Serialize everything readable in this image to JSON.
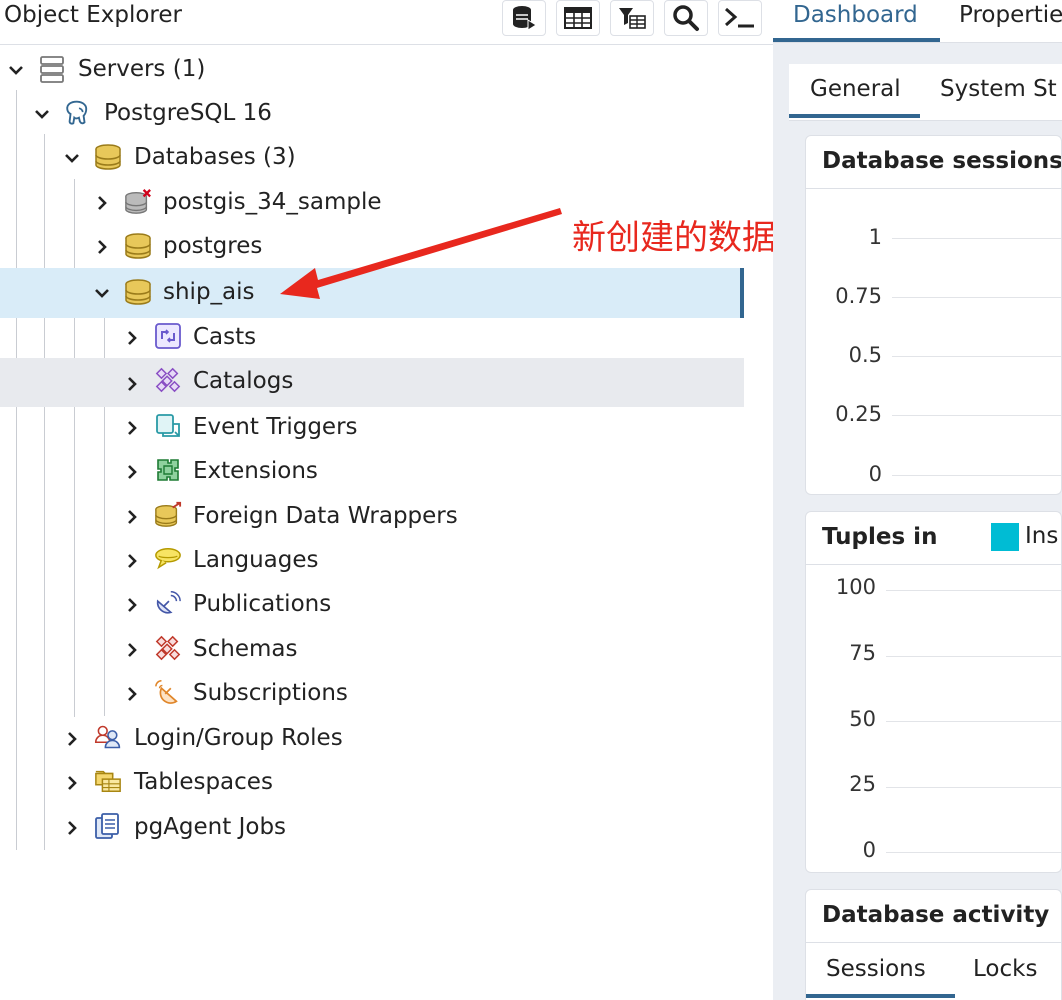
{
  "object_explorer": {
    "title": "Object Explorer",
    "toolbar": [
      {
        "icon": "query-tool-icon"
      },
      {
        "icon": "view-data-icon"
      },
      {
        "icon": "filtered-rows-icon"
      },
      {
        "icon": "search-icon"
      },
      {
        "icon": "psql-tool-icon"
      }
    ]
  },
  "tree": [
    {
      "label": "Servers (1)",
      "icon": "servers-icon",
      "expanded": true
    },
    {
      "label": "PostgreSQL 16",
      "icon": "postgresql-elephant-icon",
      "expanded": true
    },
    {
      "label": "Databases (3)",
      "icon": "databases-icon",
      "expanded": true
    },
    {
      "label": "postgis_34_sample",
      "icon": "database-disconnected-icon",
      "expanded": false
    },
    {
      "label": "postgres",
      "icon": "database-icon",
      "expanded": false
    },
    {
      "label": "ship_ais",
      "icon": "database-icon",
      "expanded": true,
      "selected": true
    },
    {
      "label": "Casts",
      "icon": "casts-icon",
      "expanded": false
    },
    {
      "label": "Catalogs",
      "icon": "catalogs-icon",
      "expanded": false
    },
    {
      "label": "Event Triggers",
      "icon": "event-triggers-icon",
      "expanded": false
    },
    {
      "label": "Extensions",
      "icon": "extensions-icon",
      "expanded": false
    },
    {
      "label": "Foreign Data Wrappers",
      "icon": "foreign-data-wrappers-icon",
      "expanded": false
    },
    {
      "label": "Languages",
      "icon": "languages-icon",
      "expanded": false
    },
    {
      "label": "Publications",
      "icon": "publications-icon",
      "expanded": false
    },
    {
      "label": "Schemas",
      "icon": "schemas-icon",
      "expanded": false
    },
    {
      "label": "Subscriptions",
      "icon": "subscriptions-icon",
      "expanded": false
    },
    {
      "label": "Login/Group Roles",
      "icon": "login-group-roles-icon",
      "expanded": false
    },
    {
      "label": "Tablespaces",
      "icon": "tablespaces-icon",
      "expanded": false
    },
    {
      "label": "pgAgent Jobs",
      "icon": "pgagent-jobs-icon",
      "expanded": false
    }
  ],
  "annotation": {
    "text": "新创建的数据库",
    "color": "#e8281e"
  },
  "main_tabs": [
    "Dashboard",
    "Properties"
  ],
  "dashboard_tabs": [
    "General",
    "System St"
  ],
  "cards": {
    "database_sessions": {
      "title": "Database sessions",
      "ticks": [
        "1",
        "0.75",
        "0.5",
        "0.25",
        "0"
      ]
    },
    "tuples_in": {
      "title": "Tuples in",
      "legend_first": "Ins",
      "legend_color": "#00bcd4",
      "ticks": [
        "100",
        "75",
        "50",
        "25",
        "0"
      ]
    },
    "database_activity": {
      "title": "Database activity",
      "tabs": [
        "Sessions",
        "Locks"
      ]
    }
  },
  "colors": {
    "accent": "#326690",
    "selection": "#d9ecf8",
    "hover": "#e8eaee"
  }
}
